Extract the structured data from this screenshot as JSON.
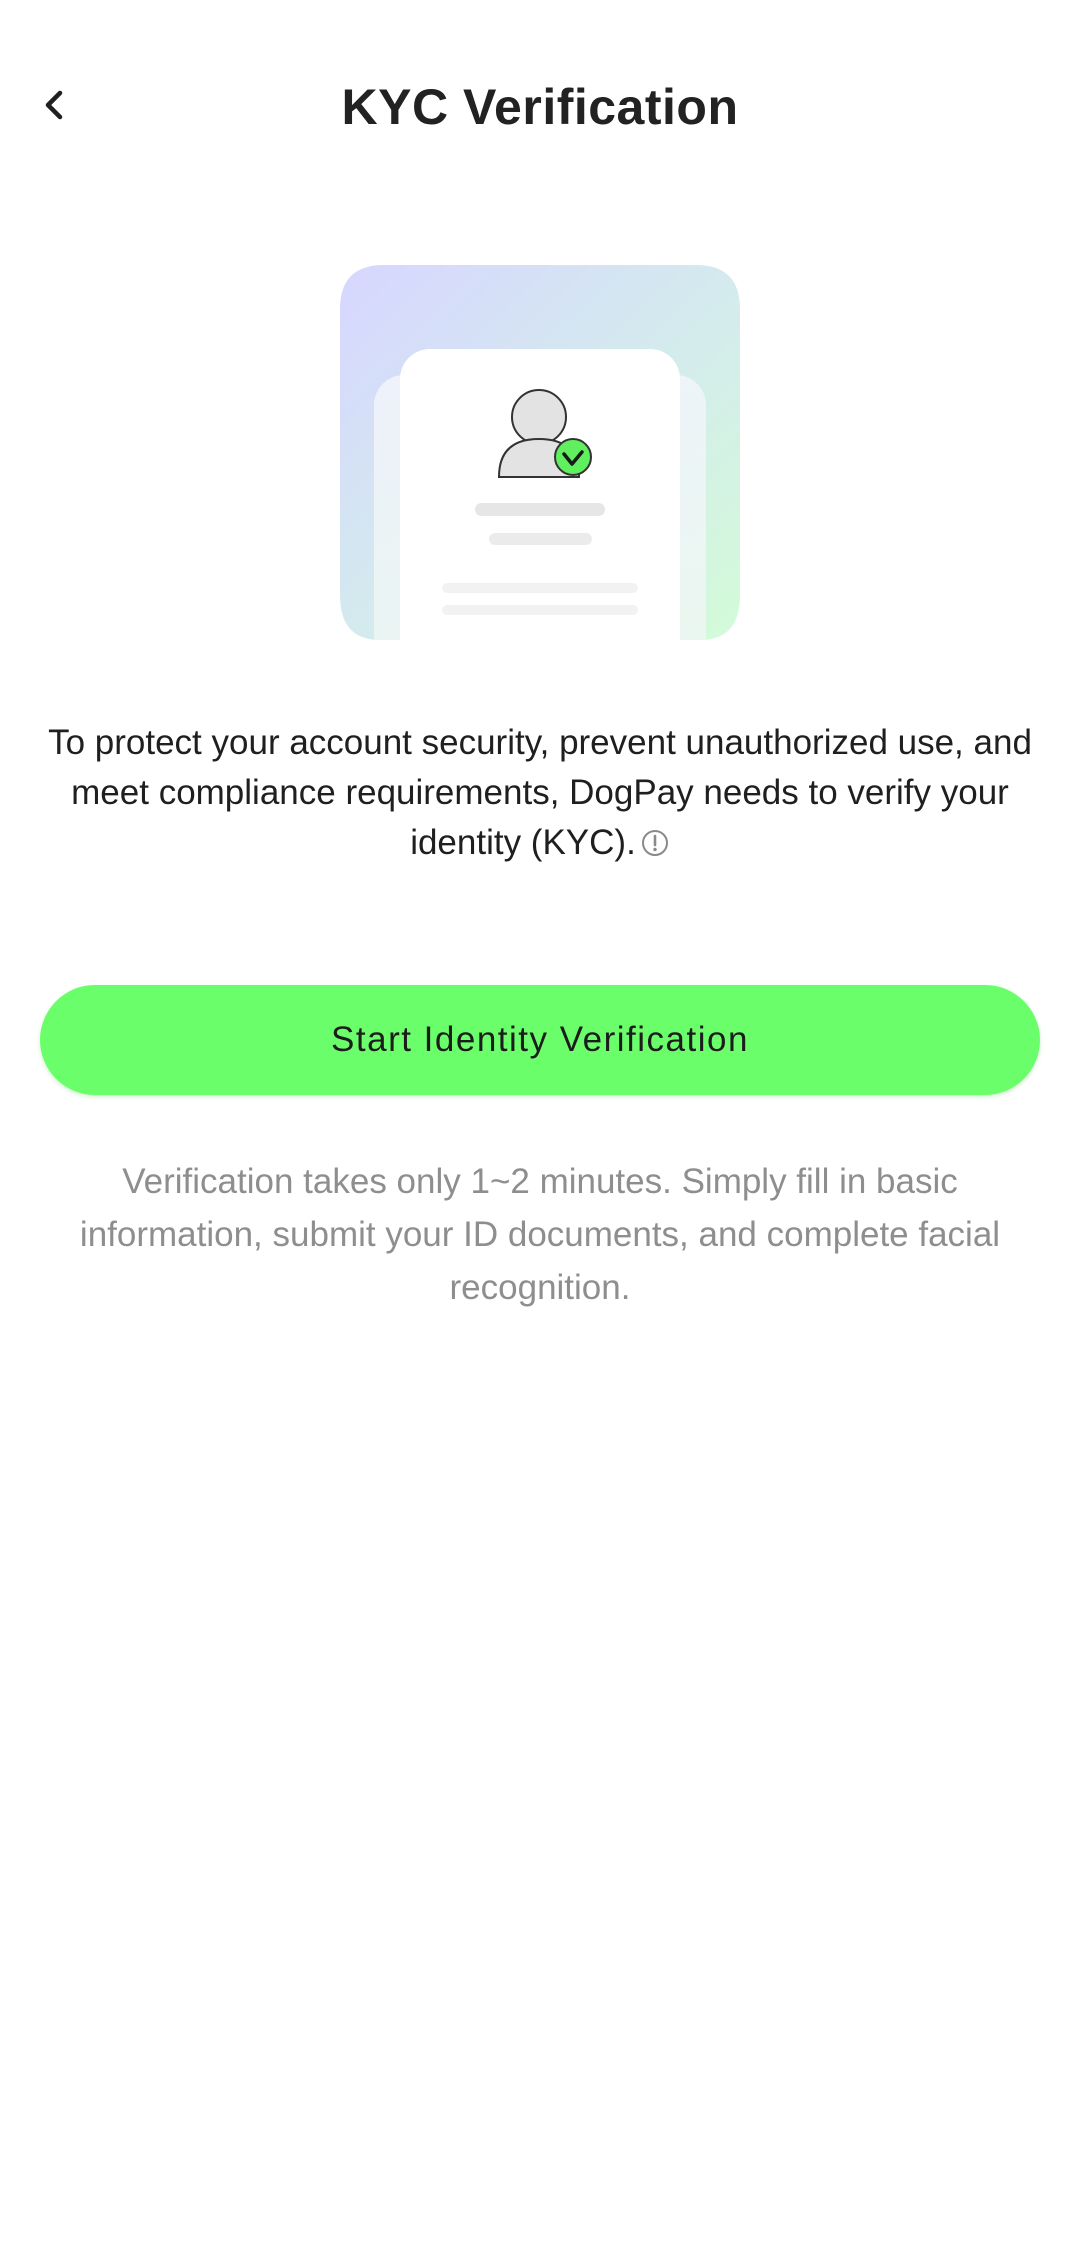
{
  "header": {
    "back_icon": "chevron-left-icon",
    "title": "KYC Verification"
  },
  "illustration": {
    "icon": "id-card-verified-icon",
    "accent_color": "#6aff6a"
  },
  "intro": {
    "text": "To protect your account security, prevent unauthorized use, and meet compliance requirements, DogPay needs to verify your identity (KYC).",
    "info_icon": "info-circle-icon"
  },
  "actions": {
    "start_label": "Start Identity Verification",
    "button_color": "#6aff6a"
  },
  "note": {
    "text": "Verification takes only 1~2 minutes. Simply fill in basic information, submit your ID documents, and complete facial recognition."
  }
}
